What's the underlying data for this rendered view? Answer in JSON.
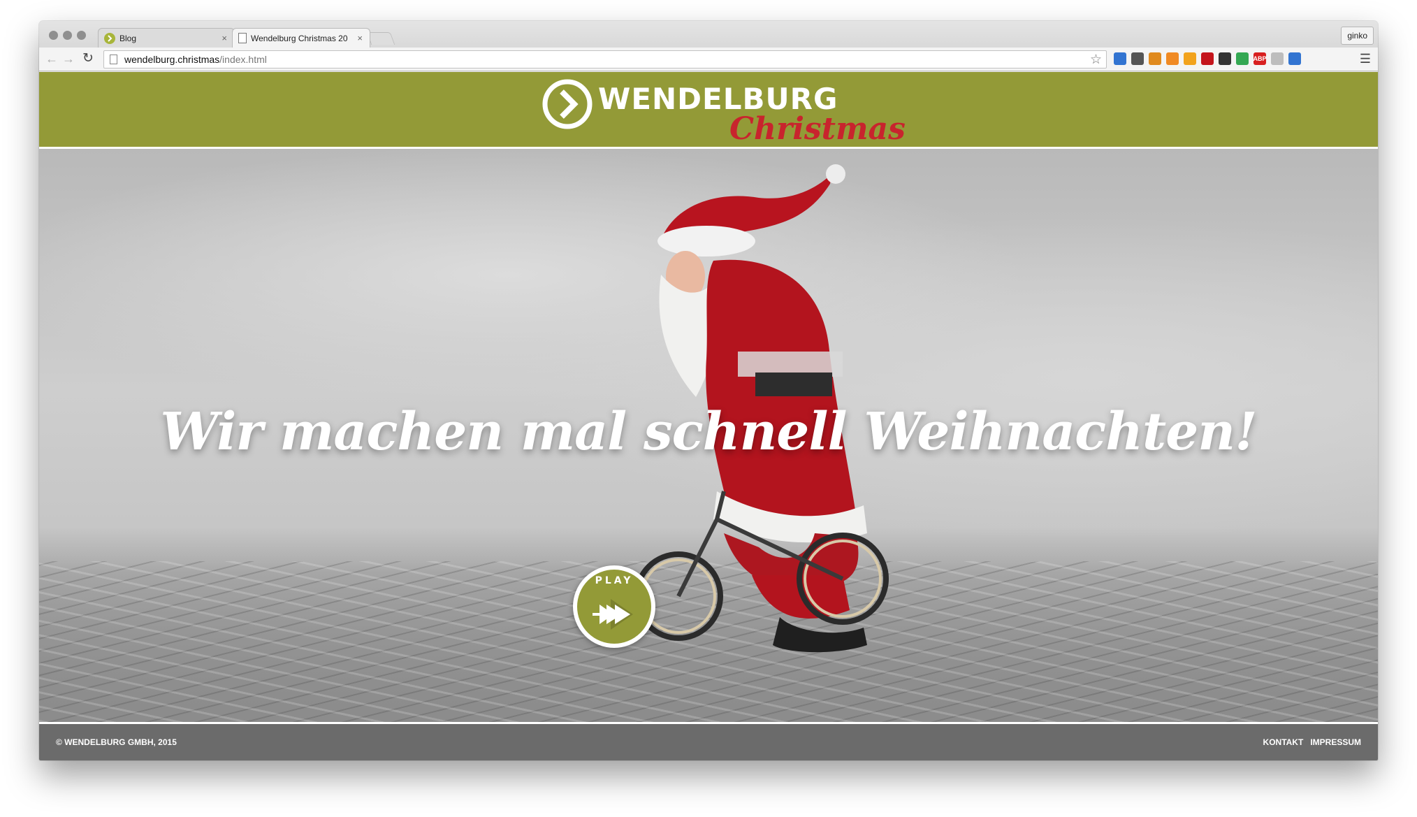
{
  "browser": {
    "tabs": [
      {
        "title": "Blog",
        "close": "×"
      },
      {
        "title": "Wendelburg Christmas 20",
        "close": "×"
      }
    ],
    "profile": "ginko",
    "url": {
      "host": "wendelburg.christmas",
      "path": "/index.html"
    },
    "extensions": [
      {
        "name": "delicious-icon",
        "color": "#3274d1"
      },
      {
        "name": "eyedropper-icon",
        "color": "#555555"
      },
      {
        "name": "ruler-icon",
        "color": "#e08a1e"
      },
      {
        "name": "chart-icon",
        "color": "#f08a24"
      },
      {
        "name": "face-icon",
        "color": "#f2a31d"
      },
      {
        "name": "lastpass-icon",
        "color": "#c4151c"
      },
      {
        "name": "star-icon",
        "color": "#333333"
      },
      {
        "name": "chrome-apps-icon",
        "color": "#34a853"
      },
      {
        "name": "adblock-icon",
        "color": "#d82020",
        "label": "ABP"
      },
      {
        "name": "grey-ext-icon",
        "color": "#bdbdbd"
      },
      {
        "name": "delicious-icon-2",
        "color": "#3274d1"
      }
    ]
  },
  "site": {
    "logo": {
      "word": "WENDELBURG",
      "script": "Christmas"
    },
    "hero": {
      "headline": "Wir machen mal schnell Weihnachten!",
      "play_label": "PLAY"
    },
    "footer": {
      "copyright": "© WENDELBURG GMBH, 2015",
      "links": [
        "KONTAKT",
        "IMPRESSUM"
      ]
    }
  },
  "colors": {
    "brand_green": "#939a37",
    "brand_red": "#c8242d",
    "footer_grey": "#6b6b6b"
  }
}
